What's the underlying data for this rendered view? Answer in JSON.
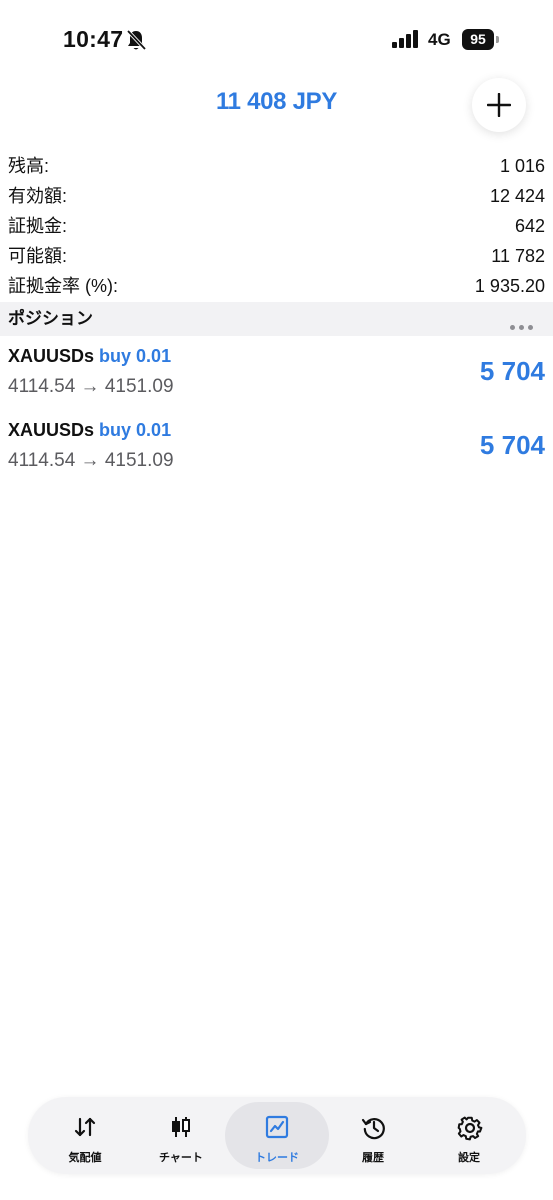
{
  "status_bar": {
    "time": "10:47",
    "network": "4G",
    "battery": "95",
    "icons": [
      "bell-slash-icon",
      "cellular-signal-icon",
      "battery-icon"
    ]
  },
  "header": {
    "balance": "11 408 JPY",
    "add_icon": "plus-icon"
  },
  "summary": [
    {
      "label": "残高:",
      "value": "1 016"
    },
    {
      "label": "有効額:",
      "value": "12 424"
    },
    {
      "label": "証拠金:",
      "value": "642"
    },
    {
      "label": "可能額:",
      "value": "11 782"
    },
    {
      "label": "証拠金率 (%):",
      "value": "1 935.20"
    }
  ],
  "positions_section": {
    "title": "ポジション",
    "more_icon": "more-horizontal-icon"
  },
  "positions": [
    {
      "symbol": "XAUUSDs",
      "side": "buy 0.01",
      "prices": "4114.54 → 4151.09",
      "profit": "5 704"
    },
    {
      "symbol": "XAUUSDs",
      "side": "buy 0.01",
      "prices": "4114.54 → 4151.09",
      "profit": "5 704"
    }
  ],
  "tabs": [
    {
      "label": "気配値",
      "icon": "quotes-arrows-icon",
      "active": false
    },
    {
      "label": "チャート",
      "icon": "candlestick-icon",
      "active": false
    },
    {
      "label": "トレード",
      "icon": "trade-chart-icon",
      "active": true
    },
    {
      "label": "履歴",
      "icon": "history-clock-icon",
      "active": false
    },
    {
      "label": "設定",
      "icon": "gear-icon",
      "active": false
    }
  ],
  "colors": {
    "accent": "#2f7be0",
    "text": "#111111",
    "secondary_text": "#5b5b5f",
    "section_bg": "#f2f2f4",
    "tab_bar_bg": "#f3f3f5"
  }
}
